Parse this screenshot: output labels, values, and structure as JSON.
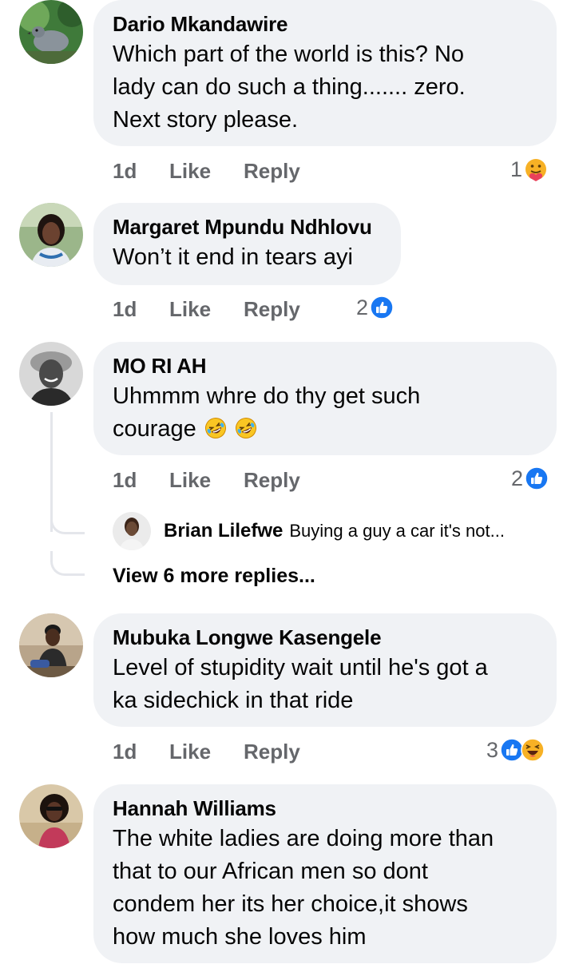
{
  "comments": [
    {
      "author": "Dario Mkandawire",
      "lines": [
        "Which part of the world is this? No",
        "lady can do such a thing....... zero.",
        "Next story please."
      ],
      "time": "1d",
      "like": "Like",
      "reply": "Reply",
      "reaction_count": "1",
      "reactions": [
        "care"
      ]
    },
    {
      "author": "Margaret Mpundu Ndhlovu",
      "lines": [
        "Won’t it end in tears ayi"
      ],
      "time": "1d",
      "like": "Like",
      "reply": "Reply",
      "reaction_count": "2",
      "reactions": [
        "like"
      ]
    },
    {
      "author": "MO RI AH",
      "lines": [
        "Uhmmm whre do thy get such",
        "courage"
      ],
      "time": "1d",
      "like": "Like",
      "reply": "Reply",
      "reaction_count": "2",
      "reactions": [
        "like"
      ],
      "inline_emojis": [
        "rolling-laughing",
        "rolling-laughing"
      ],
      "reply_preview": {
        "author": "Brian Lilefwe",
        "text": "Buying a guy a car it's not..."
      },
      "view_more": "View 6 more replies..."
    },
    {
      "author": "Mubuka Longwe Kasengele",
      "lines": [
        "Level of stupidity wait until he's got a",
        "ka sidechick in that ride"
      ],
      "time": "1d",
      "like": "Like",
      "reply": "Reply",
      "reaction_count": "3",
      "reactions": [
        "like",
        "haha"
      ]
    },
    {
      "author": "Hannah Williams",
      "lines": [
        "The white ladies are doing more than",
        "that to our African men so dont",
        "condem her its her choice,it shows",
        "how much she loves him"
      ]
    }
  ],
  "colors": {
    "bubble": "#f0f2f5",
    "secondary_text": "#65676b",
    "like_blue": "#1877f2",
    "thread_line": "#e4e6eb"
  }
}
